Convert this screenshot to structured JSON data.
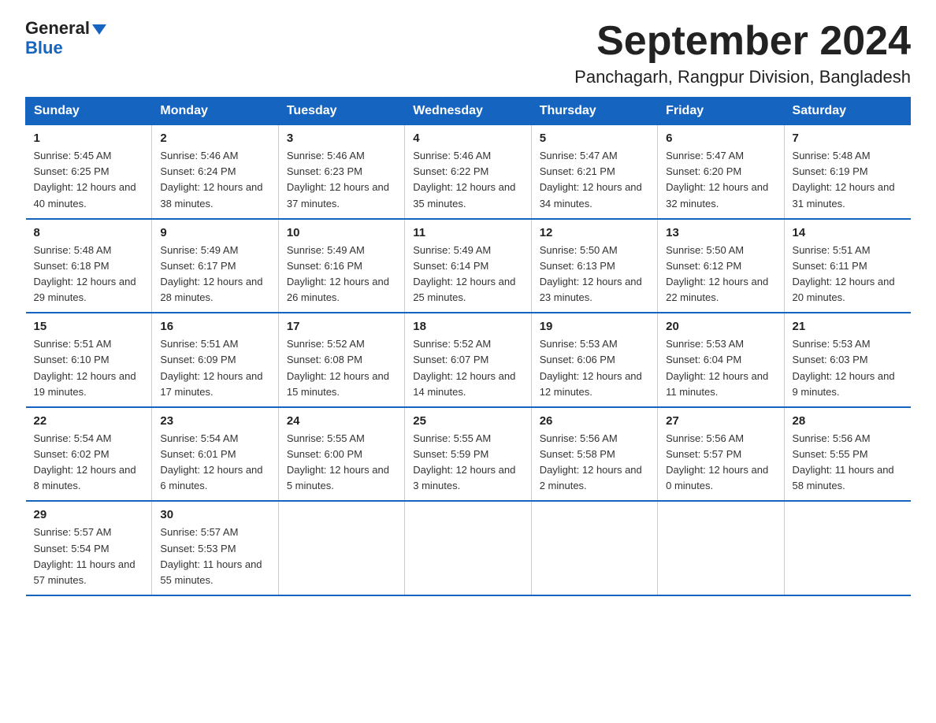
{
  "logo": {
    "line1": "General",
    "triangle": "▶",
    "line2": "Blue"
  },
  "title": "September 2024",
  "subtitle": "Panchagarh, Rangpur Division, Bangladesh",
  "days_of_week": [
    "Sunday",
    "Monday",
    "Tuesday",
    "Wednesday",
    "Thursday",
    "Friday",
    "Saturday"
  ],
  "weeks": [
    [
      {
        "day": "1",
        "sunrise": "5:45 AM",
        "sunset": "6:25 PM",
        "daylight": "12 hours and 40 minutes."
      },
      {
        "day": "2",
        "sunrise": "5:46 AM",
        "sunset": "6:24 PM",
        "daylight": "12 hours and 38 minutes."
      },
      {
        "day": "3",
        "sunrise": "5:46 AM",
        "sunset": "6:23 PM",
        "daylight": "12 hours and 37 minutes."
      },
      {
        "day": "4",
        "sunrise": "5:46 AM",
        "sunset": "6:22 PM",
        "daylight": "12 hours and 35 minutes."
      },
      {
        "day": "5",
        "sunrise": "5:47 AM",
        "sunset": "6:21 PM",
        "daylight": "12 hours and 34 minutes."
      },
      {
        "day": "6",
        "sunrise": "5:47 AM",
        "sunset": "6:20 PM",
        "daylight": "12 hours and 32 minutes."
      },
      {
        "day": "7",
        "sunrise": "5:48 AM",
        "sunset": "6:19 PM",
        "daylight": "12 hours and 31 minutes."
      }
    ],
    [
      {
        "day": "8",
        "sunrise": "5:48 AM",
        "sunset": "6:18 PM",
        "daylight": "12 hours and 29 minutes."
      },
      {
        "day": "9",
        "sunrise": "5:49 AM",
        "sunset": "6:17 PM",
        "daylight": "12 hours and 28 minutes."
      },
      {
        "day": "10",
        "sunrise": "5:49 AM",
        "sunset": "6:16 PM",
        "daylight": "12 hours and 26 minutes."
      },
      {
        "day": "11",
        "sunrise": "5:49 AM",
        "sunset": "6:14 PM",
        "daylight": "12 hours and 25 minutes."
      },
      {
        "day": "12",
        "sunrise": "5:50 AM",
        "sunset": "6:13 PM",
        "daylight": "12 hours and 23 minutes."
      },
      {
        "day": "13",
        "sunrise": "5:50 AM",
        "sunset": "6:12 PM",
        "daylight": "12 hours and 22 minutes."
      },
      {
        "day": "14",
        "sunrise": "5:51 AM",
        "sunset": "6:11 PM",
        "daylight": "12 hours and 20 minutes."
      }
    ],
    [
      {
        "day": "15",
        "sunrise": "5:51 AM",
        "sunset": "6:10 PM",
        "daylight": "12 hours and 19 minutes."
      },
      {
        "day": "16",
        "sunrise": "5:51 AM",
        "sunset": "6:09 PM",
        "daylight": "12 hours and 17 minutes."
      },
      {
        "day": "17",
        "sunrise": "5:52 AM",
        "sunset": "6:08 PM",
        "daylight": "12 hours and 15 minutes."
      },
      {
        "day": "18",
        "sunrise": "5:52 AM",
        "sunset": "6:07 PM",
        "daylight": "12 hours and 14 minutes."
      },
      {
        "day": "19",
        "sunrise": "5:53 AM",
        "sunset": "6:06 PM",
        "daylight": "12 hours and 12 minutes."
      },
      {
        "day": "20",
        "sunrise": "5:53 AM",
        "sunset": "6:04 PM",
        "daylight": "12 hours and 11 minutes."
      },
      {
        "day": "21",
        "sunrise": "5:53 AM",
        "sunset": "6:03 PM",
        "daylight": "12 hours and 9 minutes."
      }
    ],
    [
      {
        "day": "22",
        "sunrise": "5:54 AM",
        "sunset": "6:02 PM",
        "daylight": "12 hours and 8 minutes."
      },
      {
        "day": "23",
        "sunrise": "5:54 AM",
        "sunset": "6:01 PM",
        "daylight": "12 hours and 6 minutes."
      },
      {
        "day": "24",
        "sunrise": "5:55 AM",
        "sunset": "6:00 PM",
        "daylight": "12 hours and 5 minutes."
      },
      {
        "day": "25",
        "sunrise": "5:55 AM",
        "sunset": "5:59 PM",
        "daylight": "12 hours and 3 minutes."
      },
      {
        "day": "26",
        "sunrise": "5:56 AM",
        "sunset": "5:58 PM",
        "daylight": "12 hours and 2 minutes."
      },
      {
        "day": "27",
        "sunrise": "5:56 AM",
        "sunset": "5:57 PM",
        "daylight": "12 hours and 0 minutes."
      },
      {
        "day": "28",
        "sunrise": "5:56 AM",
        "sunset": "5:55 PM",
        "daylight": "11 hours and 58 minutes."
      }
    ],
    [
      {
        "day": "29",
        "sunrise": "5:57 AM",
        "sunset": "5:54 PM",
        "daylight": "11 hours and 57 minutes."
      },
      {
        "day": "30",
        "sunrise": "5:57 AM",
        "sunset": "5:53 PM",
        "daylight": "11 hours and 55 minutes."
      },
      null,
      null,
      null,
      null,
      null
    ]
  ]
}
